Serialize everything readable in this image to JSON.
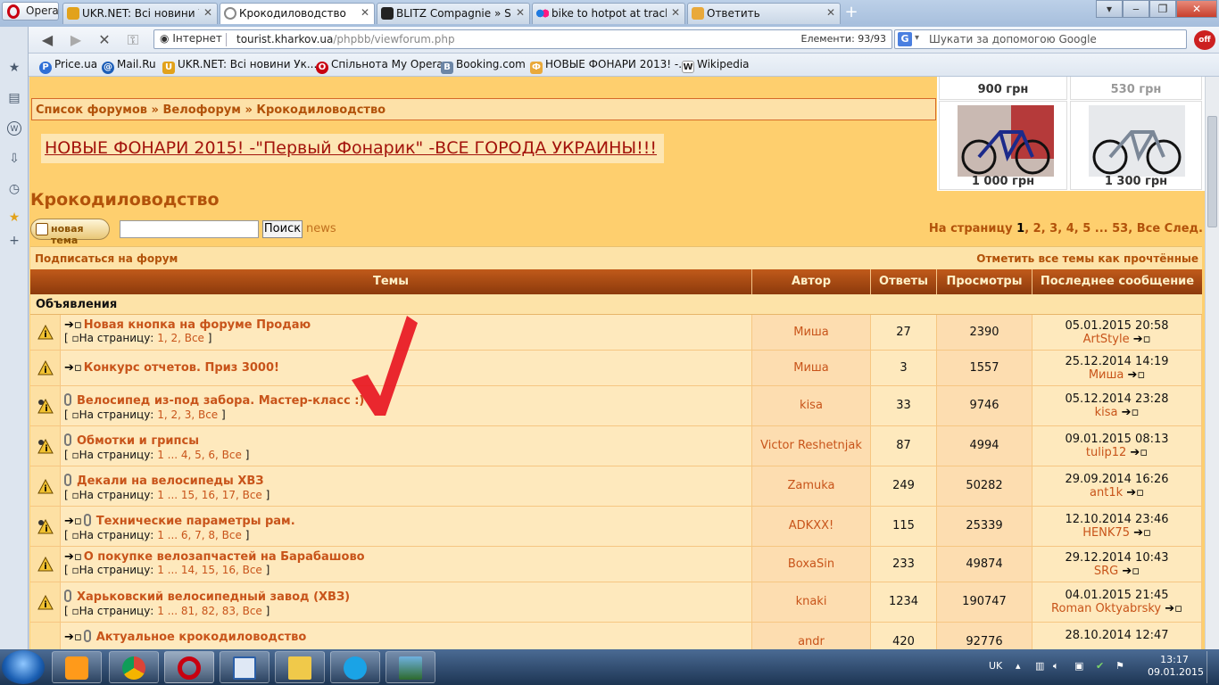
{
  "browser": {
    "opera_label": "Opera",
    "tabs": [
      {
        "title": "UKR.NET: Всі новини У...",
        "color": "#e2a21b"
      },
      {
        "title": "Крокодиловодство",
        "color": "#cfd6df"
      },
      {
        "title": "BLITZ Compagnie » Sc...",
        "color": "#222222"
      },
      {
        "title": "bike to hotpot at trackr...",
        "color": "#1f7ae0"
      },
      {
        "title": "Ответить",
        "color": "#e9a93a"
      }
    ],
    "address": {
      "security_label": "Інтернет",
      "url_host": "tourist.kharkov.ua",
      "url_path": "/phpbb/viewforum.php",
      "elements_label": "Елементи:",
      "elements_value": "93/93"
    },
    "search": {
      "engine": "G",
      "placeholder": "Шукати за допомогою Google"
    },
    "adblock_label": "off",
    "bookmarks": [
      {
        "label": "Price.ua",
        "color": "#2f6fd6",
        "glyph": "P"
      },
      {
        "label": "Mail.Ru",
        "color": "#1e5fb8",
        "glyph": "@"
      },
      {
        "label": "UKR.NET: Всі новини Ук...",
        "color": "#e2a21b",
        "glyph": "U"
      },
      {
        "label": "Спільнота My Opera",
        "color": "#c80010",
        "glyph": "O"
      },
      {
        "label": "Booking.com",
        "color": "#6c86a6",
        "glyph": "B"
      },
      {
        "label": "НОВЫЕ ФОНАРИ 2013! -...",
        "color": "#e9a93a",
        "glyph": "Ф"
      },
      {
        "label": "Wikipedia",
        "color": "#222222",
        "glyph": "W"
      }
    ]
  },
  "forum": {
    "breadcrumb": {
      "home": "Список форумов",
      "sep": "»",
      "section": "Велофорум",
      "current": "Крокодиловодство"
    },
    "banner": "НОВЫЕ ФОНАРИ 2015! -\"Первый Фонарик\" -ВСЕ ГОРОДА УКРАИНЫ!!!",
    "title": "Крокодиловодство",
    "new_topic_label": "новая тема",
    "search_button": "Поиск",
    "news_link": "news",
    "pagination": {
      "label": "На страницу",
      "current": "1",
      "p2": "2",
      "p3": "3",
      "p4": "4",
      "p5": "5",
      "ellipsis": "...",
      "last": "53",
      "all": "Все",
      "next": "След."
    },
    "subscribe": "Подписаться на форум",
    "mark_read": "Отметить все темы как прочтённые",
    "columns": {
      "topics": "Темы",
      "author": "Автор",
      "replies": "Ответы",
      "views": "Просмотры",
      "last": "Последнее сообщение"
    },
    "announcements_label": "Объявления",
    "pages_prefix": "На страницу:",
    "rows": [
      {
        "title": "Новая кнопка на форуме Продаю",
        "pages": "1, 2, Все",
        "author": "Миша",
        "replies": "27",
        "views": "2390",
        "last_date": "05.01.2015 20:58",
        "last_user": "ArtStyle"
      },
      {
        "title": "Конкурс отчетов. Приз 3000!",
        "pages": "",
        "author": "Миша",
        "replies": "3",
        "views": "1557",
        "last_date": "25.12.2014 14:19",
        "last_user": "Миша"
      },
      {
        "title": "Велосипед из-под забора. Мастер-класс :)",
        "pages": "1, 2, 3, Все",
        "author": "kisa",
        "replies": "33",
        "views": "9746",
        "last_date": "05.12.2014 23:28",
        "last_user": "kisa"
      },
      {
        "title": "Обмотки и грипсы",
        "pages": "1 ... 4, 5, 6, Все",
        "author": "Victor Reshetnjak",
        "replies": "87",
        "views": "4994",
        "last_date": "09.01.2015 08:13",
        "last_user": "tulip12"
      },
      {
        "title": "Декали на велосипеды ХВЗ",
        "pages": "1 ... 15, 16, 17, Все",
        "author": "Zamuka",
        "replies": "249",
        "views": "50282",
        "last_date": "29.09.2014 16:26",
        "last_user": "ant1k"
      },
      {
        "title": "Технические параметры рам.",
        "pages": "1 ... 6, 7, 8, Все",
        "author": "ADKXX!",
        "replies": "115",
        "views": "25339",
        "last_date": "12.10.2014 23:46",
        "last_user": "HENK75"
      },
      {
        "title": "О покупке велозапчастей на Барабашово",
        "pages": "1 ... 14, 15, 16, Все",
        "author": "BoxaSin",
        "replies": "233",
        "views": "49874",
        "last_date": "29.12.2014 10:43",
        "last_user": "SRG"
      },
      {
        "title": "Харьковский велосипедный завод (ХВЗ)",
        "pages": "1 ... 81, 82, 83, Все",
        "author": "knaki",
        "replies": "1234",
        "views": "190747",
        "last_date": "04.01.2015 21:45",
        "last_user": "Roman Oktyabrsky"
      },
      {
        "title": "Актуальное крокодиловодство",
        "pages": "",
        "author": "andr",
        "replies": "420",
        "views": "92776",
        "last_date": "28.10.2014 12:47",
        "last_user": ""
      }
    ]
  },
  "ads": [
    {
      "price": "900 грн"
    },
    {
      "price": "530 грн"
    },
    {
      "price": "1 000 грн"
    },
    {
      "price": "1 300 грн"
    }
  ],
  "taskbar": {
    "lang": "UK",
    "time": "13:17",
    "date": "09.01.2015"
  }
}
